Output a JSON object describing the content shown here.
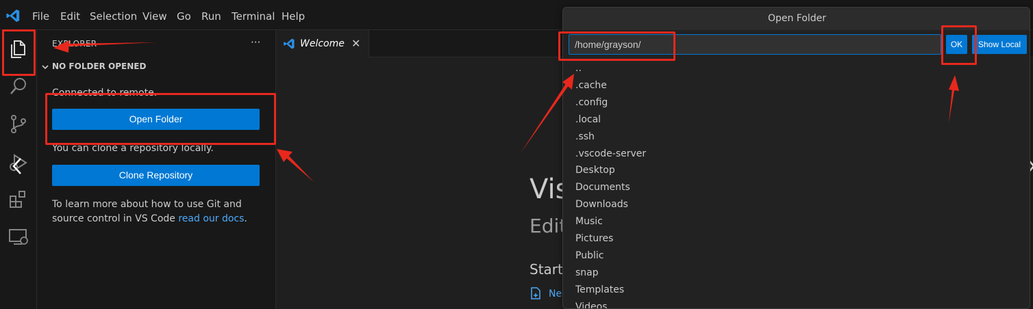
{
  "menu": {
    "items": [
      "File",
      "Edit",
      "Selection",
      "View",
      "Go",
      "Run",
      "Terminal",
      "Help"
    ]
  },
  "sidebar": {
    "title": "EXPLORER",
    "more": "···",
    "section_title": "NO FOLDER OPENED",
    "connected_text": "Connected to remote.",
    "open_folder_label": "Open Folder",
    "clone_text": "You can clone a repository locally.",
    "clone_button_label": "Clone Repository",
    "learn_text_1": "To learn more about how to use Git and",
    "learn_text_2": "source control in VS Code ",
    "learn_link": "read our docs",
    "learn_end": "."
  },
  "editor": {
    "tab_label": "Welcome",
    "welcome_title": "Vis",
    "welcome_subtitle": "Edit",
    "start_heading": "Start",
    "new_link": "Ne"
  },
  "quick_input": {
    "title": "Open Folder",
    "path_value": "/home/grayson/",
    "ok_label": "OK",
    "show_local_label": "Show Local",
    "items": [
      "..",
      ".cache",
      ".config",
      ".local",
      ".ssh",
      ".vscode-server",
      "Desktop",
      "Documents",
      "Downloads",
      "Music",
      "Pictures",
      "Public",
      "snap",
      "Templates",
      "Videos"
    ]
  },
  "colors": {
    "accent": "#0078d4",
    "annotation": "#e8281d",
    "link": "#4daafc"
  },
  "icons": {
    "activity": [
      "explorer-icon",
      "search-icon",
      "source-control-icon",
      "run-debug-icon",
      "extensions-icon",
      "remote-explorer-icon"
    ]
  }
}
